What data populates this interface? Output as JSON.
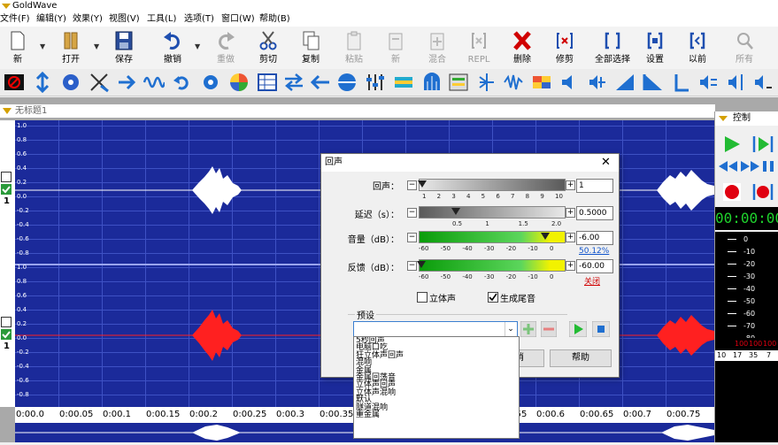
{
  "app": {
    "title": "GoldWave"
  },
  "menu": [
    "文件(F)",
    "编辑(Y)",
    "效果(Y)",
    "视图(V)",
    "工具(L)",
    "选项(T)",
    "窗口(W)",
    "帮助(B)"
  ],
  "toolbar": {
    "items": [
      {
        "label": "新",
        "icon": "new-file-icon",
        "disabled": false
      },
      {
        "label": "打开",
        "icon": "open-folder-icon",
        "disabled": false
      },
      {
        "label": "保存",
        "icon": "save-disk-icon",
        "disabled": false
      },
      {
        "label": "撤销",
        "icon": "undo-icon",
        "disabled": false
      },
      {
        "label": "重做",
        "icon": "redo-icon",
        "disabled": true
      },
      {
        "label": "剪切",
        "icon": "scissors-icon",
        "disabled": false
      },
      {
        "label": "复制",
        "icon": "copy-icon",
        "disabled": false
      },
      {
        "label": "粘贴",
        "icon": "paste-icon",
        "disabled": true
      },
      {
        "label": "新",
        "icon": "paste-new-icon",
        "disabled": true
      },
      {
        "label": "混合",
        "icon": "mix-icon",
        "disabled": true
      },
      {
        "label": "REPL",
        "icon": "replace-icon",
        "disabled": true
      },
      {
        "label": "删除",
        "icon": "delete-x-icon",
        "disabled": false
      },
      {
        "label": "修剪",
        "icon": "trim-icon",
        "disabled": false
      },
      {
        "label": "全部选择",
        "icon": "select-all-icon",
        "disabled": false
      },
      {
        "label": "设置",
        "icon": "set-selection-icon",
        "disabled": false
      },
      {
        "label": "以前",
        "icon": "previous-selection-icon",
        "disabled": false
      },
      {
        "label": "所有",
        "icon": "zoom-all-icon",
        "disabled": true
      }
    ]
  },
  "document": {
    "title": "无标题1"
  },
  "waveform": {
    "amplitude_ticks": [
      "1.0",
      "0.8",
      "0.6",
      "0.4",
      "0.2",
      "0.0",
      "-0.2",
      "-0.4",
      "-0.6",
      "-0.8",
      "1.0",
      "0.8",
      "0.6",
      "0.4",
      "0.2",
      "0.0",
      "-0.2",
      "-0.4",
      "-0.6",
      "-0.8"
    ],
    "channel_number_1": "1",
    "channel_number_2": "1",
    "time_ticks": [
      "0:00.0",
      "0:00.05",
      "0:00.1",
      "0:00.15",
      "0:00.2",
      "0:00.25",
      "0:00.3",
      "0:00.35",
      "0:00.4",
      "0:00.45",
      "0:00.5",
      "0:00.55",
      "0:00.6",
      "0:00.65",
      "0:00.7",
      "0:00.75"
    ],
    "colors": {
      "background": "#1b2a9a",
      "grid": "#3e51c4",
      "channel_left": "#ffffff",
      "channel_right": "#ff2020"
    }
  },
  "control": {
    "title": "控制",
    "time_display": "00:00:00",
    "meter_ticks": [
      "0",
      "-10",
      "-20",
      "-30",
      "-40",
      "-50",
      "-60",
      "-70",
      "-80"
    ],
    "peak_labels": [
      "100",
      "100",
      "100"
    ],
    "freq_labels": [
      "10",
      "17",
      "35",
      "7"
    ]
  },
  "dialog": {
    "title": "回声",
    "echo": {
      "label": "回声：",
      "value": "1",
      "scale": [
        "1",
        "2",
        "3",
        "4",
        "5",
        "6",
        "7",
        "8",
        "9",
        "10"
      ]
    },
    "delay": {
      "label": "延迟（s）：",
      "value": "0.5000",
      "scale": [
        "0.5",
        "1",
        "1.5",
        "2.0"
      ]
    },
    "volume": {
      "label": "音量（dB）：",
      "value": "-6.00",
      "percent": "50.12%",
      "scale": [
        "-60",
        "-50",
        "-40",
        "-30",
        "-20",
        "-10",
        "0"
      ]
    },
    "feedback": {
      "label": "反馈（dB）：",
      "value": "-60.00",
      "link": "关闭",
      "scale": [
        "-60",
        "-50",
        "-40",
        "-30",
        "-20",
        "-10",
        "0"
      ]
    },
    "stereo_label": "立体声",
    "tail_label": "生成尾音",
    "presets_label": "预设",
    "preset_input": "",
    "preset_list": [
      "5秒回声",
      "电脑口吃",
      "狂立体声回声",
      "混响",
      "金属",
      "金属回荡音",
      "立体声回声",
      "立体声混响",
      "默认",
      "隧道混响",
      "重金属"
    ],
    "partial_button": "消",
    "help_button": "帮助"
  }
}
